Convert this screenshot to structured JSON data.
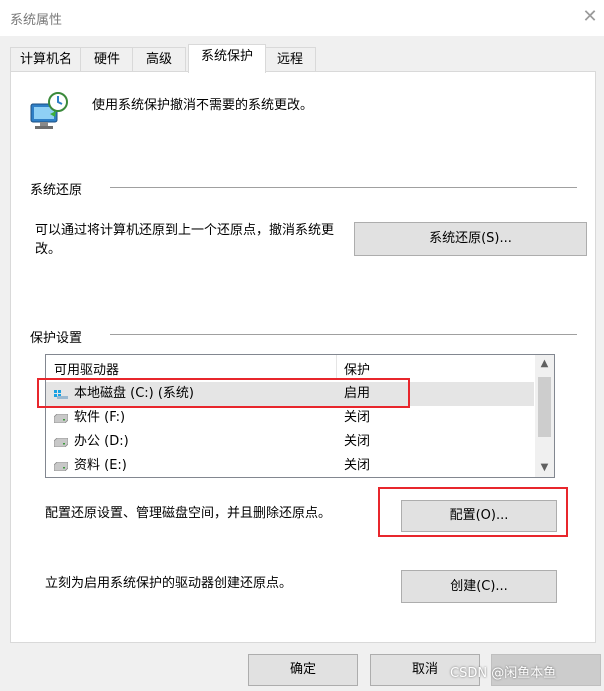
{
  "window": {
    "title": "系统属性",
    "close_glyph": "✕"
  },
  "tabs": [
    {
      "label": "计算机名"
    },
    {
      "label": "硬件"
    },
    {
      "label": "高级"
    },
    {
      "label": "系统保护"
    },
    {
      "label": "远程"
    }
  ],
  "header": {
    "description": "使用系统保护撤消不需要的系统更改。"
  },
  "system_restore": {
    "group_label": "系统还原",
    "description": "可以通过将计算机还原到上一个还原点，撤消系统更改。",
    "button_label": "系统还原(S)..."
  },
  "protection": {
    "group_label": "保护设置",
    "columns": [
      "可用驱动器",
      "保护"
    ],
    "drives": [
      {
        "name": "本地磁盘 (C:) (系统)",
        "protection": "启用",
        "icon": "system-drive-icon"
      },
      {
        "name": "软件 (F:)",
        "protection": "关闭",
        "icon": "drive-icon"
      },
      {
        "name": "办公 (D:)",
        "protection": "关闭",
        "icon": "drive-icon"
      },
      {
        "name": "资料 (E:)",
        "protection": "关闭",
        "icon": "drive-icon"
      }
    ],
    "configure_text": "配置还原设置、管理磁盘空间，并且删除还原点。",
    "configure_button": "配置(O)...",
    "create_text": "立刻为启用系统保护的驱动器创建还原点。",
    "create_button": "创建(C)..."
  },
  "footer": {
    "ok": "确定",
    "cancel": "取消",
    "watermark": "CSDN @闲鱼本鱼"
  },
  "colors": {
    "highlight": "#e8262c",
    "button_bg": "#e1e1e1",
    "accent": "#0078d7"
  }
}
